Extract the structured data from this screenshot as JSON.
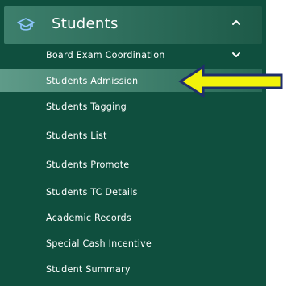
{
  "section": {
    "title": "Students",
    "icon": "graduation-cap-icon",
    "expanded": true
  },
  "menu_items": [
    {
      "label": "Board Exam Coordination",
      "has_submenu": true
    },
    {
      "label": "Students Admission",
      "active": true
    },
    {
      "label": "Students Tagging"
    },
    {
      "label": "Students List"
    },
    {
      "label": "Students Promote"
    },
    {
      "label": "Students TC Details"
    },
    {
      "label": "Academic Records"
    },
    {
      "label": "Special Cash Incentive"
    },
    {
      "label": "Student Summary"
    }
  ],
  "annotation": {
    "type": "arrow",
    "fill_color": "#f2f20a",
    "stroke_color": "#1f2e6b",
    "points_to": "Students Admission"
  },
  "colors": {
    "sidebar_bg": "#0f4f3e",
    "active_bg": "#4f8f7c",
    "text": "#ffffff"
  }
}
